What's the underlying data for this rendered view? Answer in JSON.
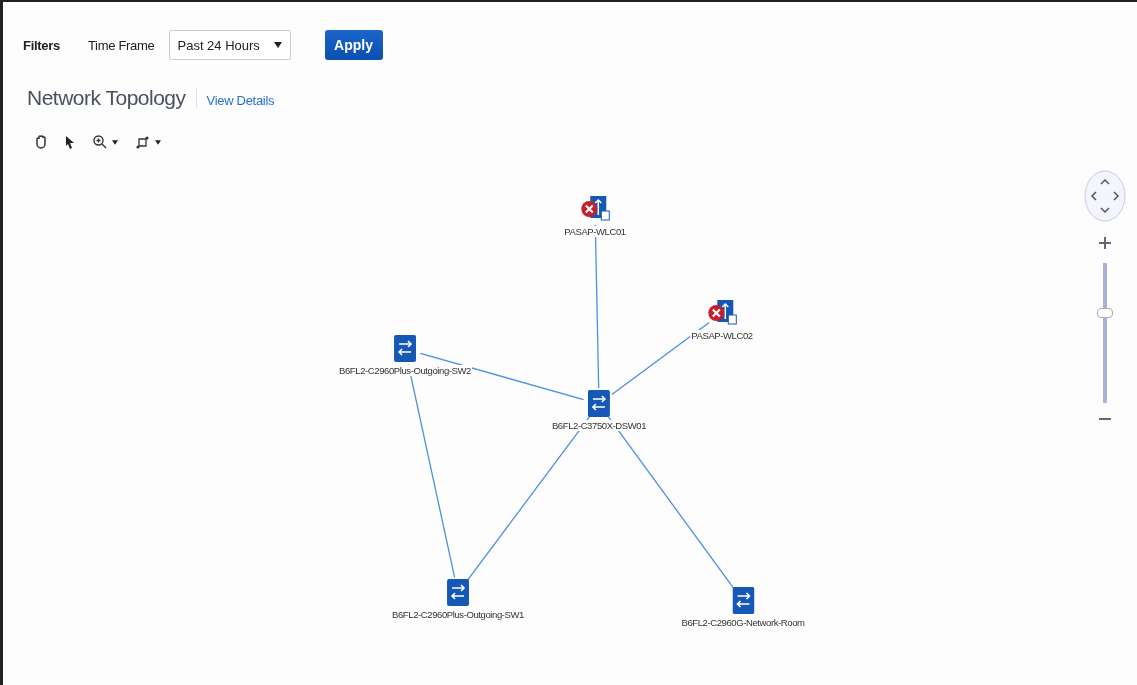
{
  "filters": {
    "label": "Filters",
    "time_frame": {
      "label": "Time Frame",
      "value": "Past 24 Hours"
    },
    "apply": "Apply"
  },
  "header": {
    "title": "Network Topology",
    "link": "View Details"
  },
  "toolbar": [
    {
      "kind": "pan",
      "dropdown": false
    },
    {
      "kind": "select",
      "dropdown": false
    },
    {
      "kind": "zoom",
      "dropdown": true
    },
    {
      "kind": "layout",
      "dropdown": true
    }
  ],
  "topology": {
    "nodes": [
      {
        "label": "PASAP-WLC01",
        "kind": "controller",
        "alarm": true
      },
      {
        "label": "PASAP-WLC02",
        "kind": "controller",
        "alarm": true
      },
      {
        "label": "B6FL2-C2960Plus-Outgoing-SW2",
        "kind": "switch",
        "alarm": false
      },
      {
        "label": "B6FL2-C3750X-DSW01",
        "kind": "switch",
        "alarm": false
      },
      {
        "label": "B6FL2-C2960Plus-Outgoing-SW1",
        "kind": "switch",
        "alarm": false
      },
      {
        "label": "B6FL2-C2960G-Network-Room",
        "kind": "switch",
        "alarm": false
      }
    ],
    "zoom": {
      "level": 0.64
    }
  }
}
